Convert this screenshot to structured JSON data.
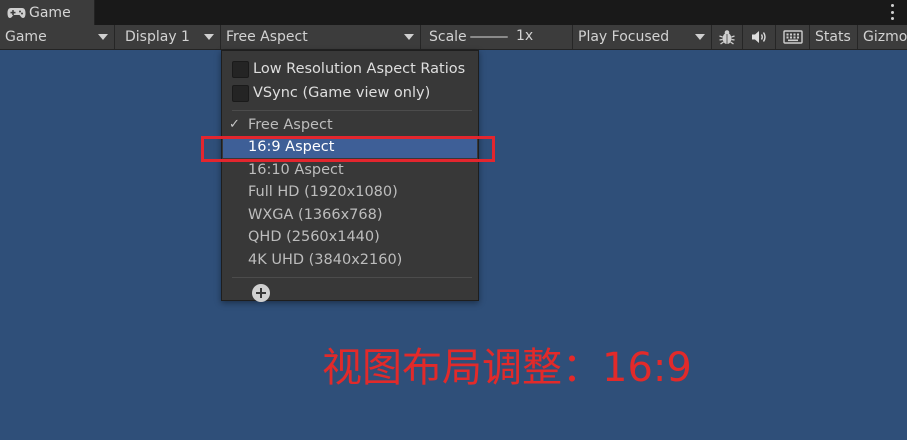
{
  "tab": {
    "icon": "gamepad-icon",
    "title": "Game"
  },
  "toolbar": {
    "view_mode": "Game",
    "display": "Display 1",
    "aspect": "Free Aspect",
    "scale_label": "Scale",
    "scale_value": "1x",
    "play_mode": "Play Focused",
    "icons": [
      "bug-icon",
      "speaker-icon",
      "keyboard-icon"
    ],
    "stats": "Stats",
    "gizmos": "Gizmos"
  },
  "dropdown": {
    "options": [
      {
        "label": "Low Resolution Aspect Ratios",
        "checked": false
      },
      {
        "label": "VSync (Game view only)",
        "checked": false
      }
    ],
    "items": [
      {
        "label": "Free Aspect",
        "selected": true,
        "highlighted": false
      },
      {
        "label": "16:9 Aspect",
        "selected": false,
        "highlighted": true
      },
      {
        "label": "16:10 Aspect",
        "selected": false,
        "highlighted": false
      },
      {
        "label": "Full HD (1920x1080)",
        "selected": false,
        "highlighted": false
      },
      {
        "label": "WXGA (1366x768)",
        "selected": false,
        "highlighted": false
      },
      {
        "label": "QHD (2560x1440)",
        "selected": false,
        "highlighted": false
      },
      {
        "label": "4K UHD (3840x2160)",
        "selected": false,
        "highlighted": false
      }
    ],
    "add_icon": "plus-circle-icon",
    "check_mark": "✓"
  },
  "annotation": {
    "caption": "视图布局调整：16:9",
    "color": "#e22a2a"
  },
  "colors": {
    "viewport": "#2f4f79",
    "highlight": "#3e5f97",
    "annotation_box": "#e3262e"
  }
}
